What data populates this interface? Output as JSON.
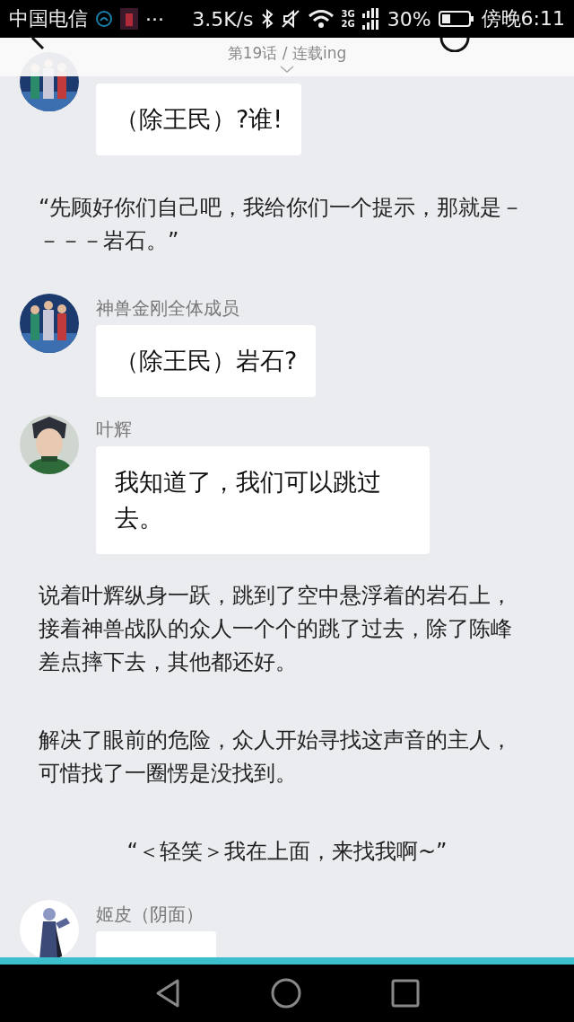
{
  "status_bar": {
    "carrier": "中国电信",
    "more": "···",
    "speed": "3.5K/s",
    "network": "3G",
    "network2": "2G",
    "battery": "30%",
    "time": "傍晚6:11"
  },
  "header": {
    "title": "第19话 / 连载ing"
  },
  "chat": [
    {
      "kind": "message",
      "text": "（除王民）?谁!"
    },
    {
      "kind": "narration",
      "text": "“先顾好你们自己吧，我给你们一个提示，那就是－－－－岩石。”"
    },
    {
      "kind": "message",
      "name": "神兽金刚全体成员",
      "text": "（除王民）岩石?"
    },
    {
      "kind": "message",
      "name": "叶辉",
      "text": "我知道了，我们可以跳过去。"
    },
    {
      "kind": "narration",
      "text": "说着叶辉纵身一跃，跳到了空中悬浮着的岩石上，接着神兽战队的众人一个个的跳了过去，除了陈峰差点摔下去，其他都还好。"
    },
    {
      "kind": "narration",
      "text": "解决了眼前的危险，众人开始寻找这声音的主人，可惜找了一圈愣是没找到。"
    },
    {
      "kind": "centered_narration",
      "text": "“＜轻笑＞我在上面，来找我啊~”"
    },
    {
      "kind": "message",
      "name": "姬皮（阴面）"
    }
  ]
}
